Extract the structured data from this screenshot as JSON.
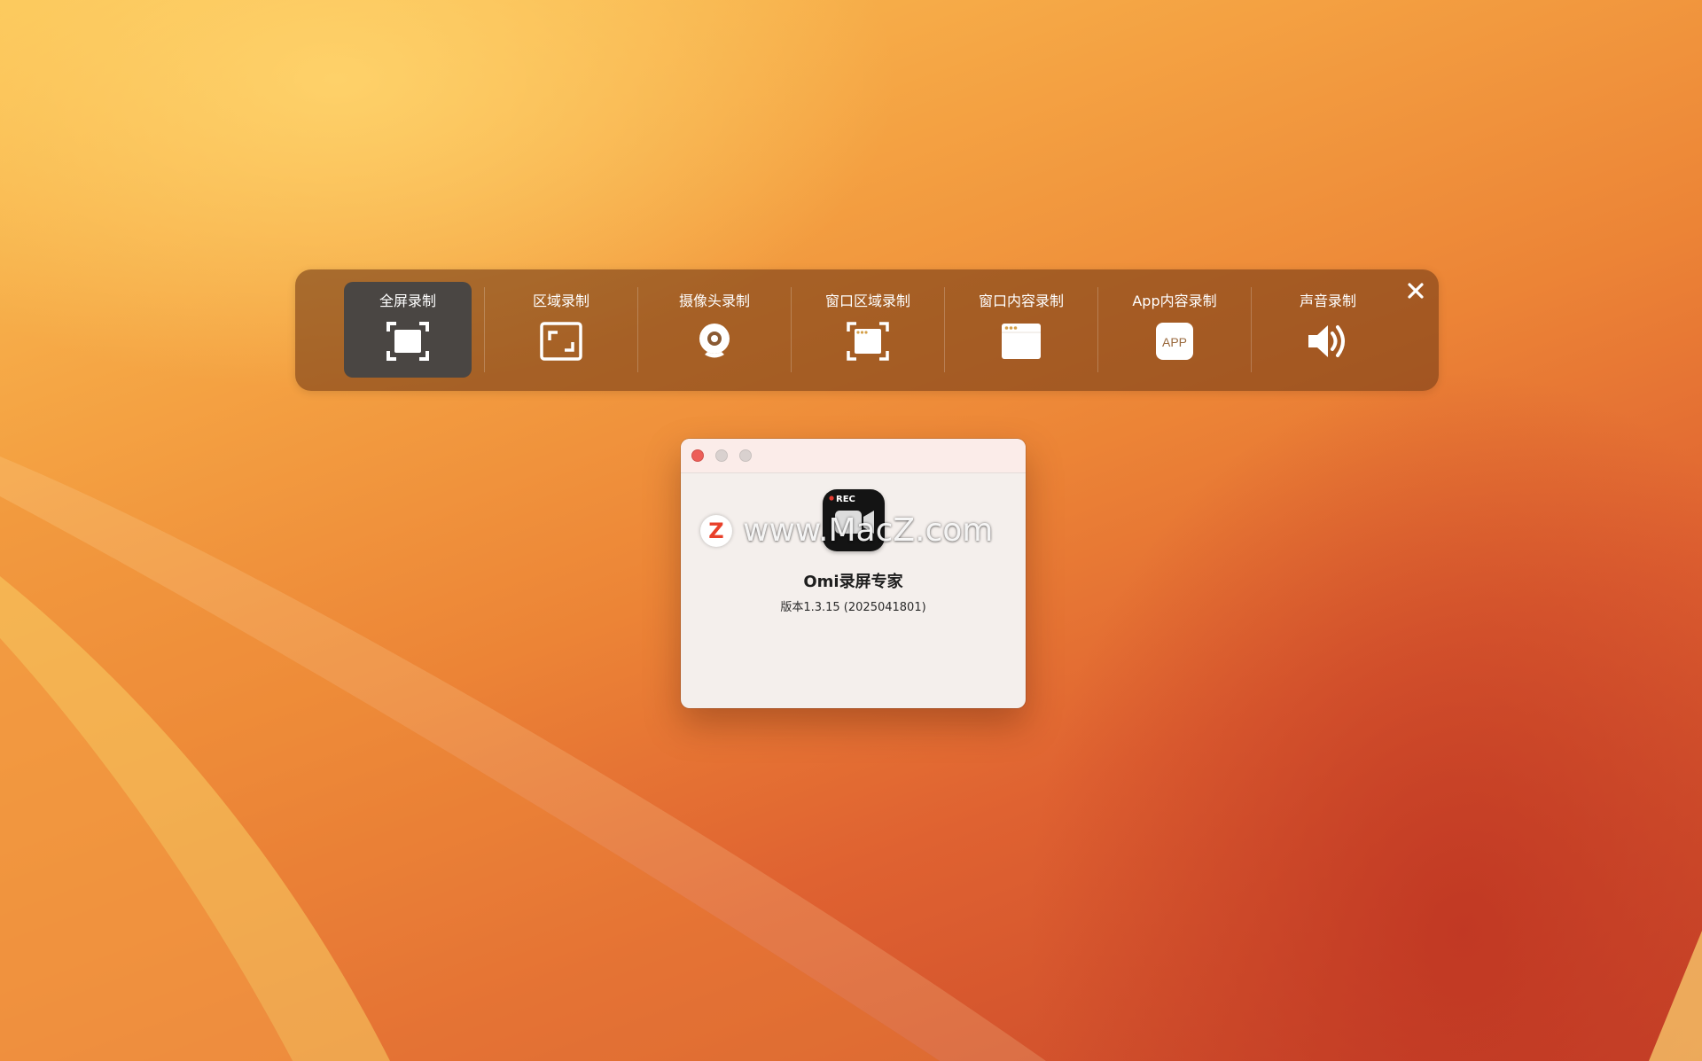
{
  "toolbar": {
    "tools": [
      {
        "label": "全屏录制",
        "icon": "fullscreen-record-icon",
        "selected": true
      },
      {
        "label": "区域录制",
        "icon": "area-record-icon"
      },
      {
        "label": "摄像头录制",
        "icon": "webcam-icon"
      },
      {
        "label": "窗口区域录制",
        "icon": "window-area-record-icon"
      },
      {
        "label": "窗口内容录制",
        "icon": "window-content-record-icon"
      },
      {
        "label": "App内容录制",
        "icon": "app-content-record-icon",
        "icon_text": "APP"
      },
      {
        "label": "声音录制",
        "icon": "speaker-icon"
      }
    ],
    "close_icon": "close-icon"
  },
  "about": {
    "app_name": "Omi录屏专家",
    "version": "版本1.3.15 (2025041801)",
    "icon_badge": "REC",
    "traffic_lights": {
      "close": "#ed5e58",
      "minimize": "#d9d1cf",
      "maximize": "#d9d1cf"
    }
  },
  "watermark": {
    "logo_letter": "Z",
    "text": "www.MacZ.com"
  },
  "colors": {
    "toolbar_bg": "#7a3e16",
    "selected_tool_bg": "#444444",
    "window_bg": "#f4efec",
    "titlebar_bg": "#fbece9",
    "watermark_logo": "#e8402a"
  }
}
